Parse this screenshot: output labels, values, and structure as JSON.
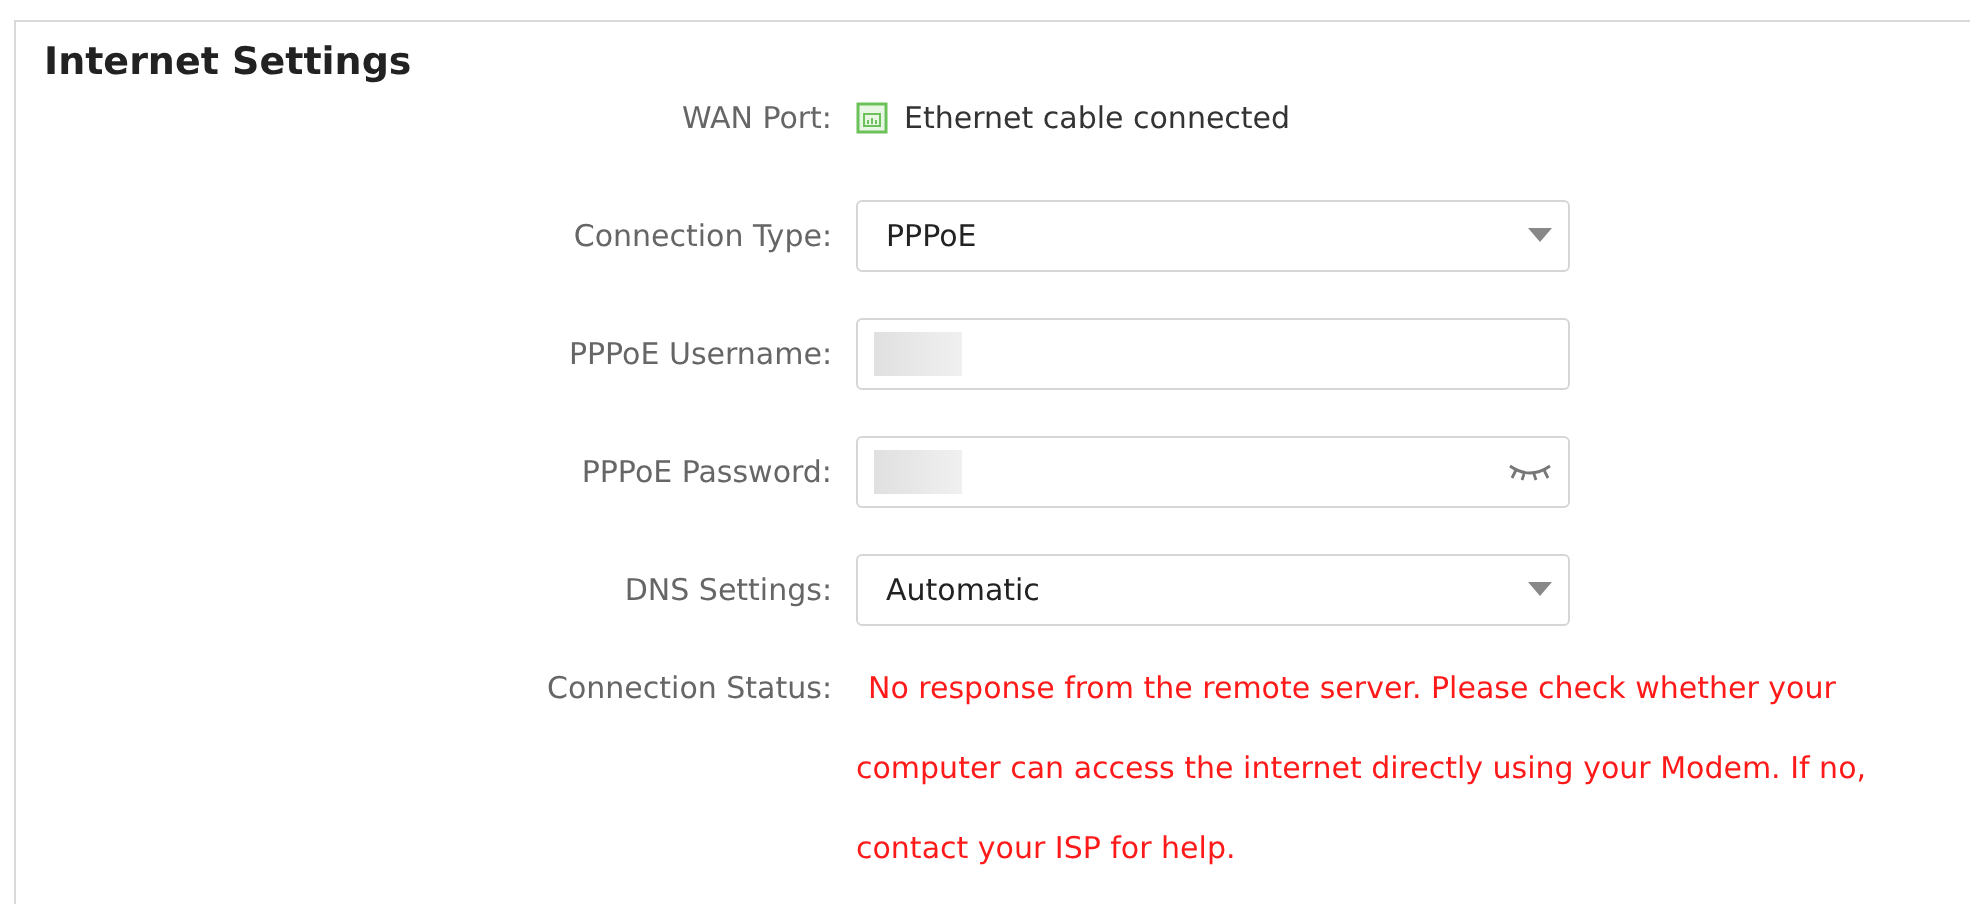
{
  "title": "Internet Settings",
  "rows": [
    {
      "kind": "status",
      "label": "WAN Port:",
      "value": "Ethernet cable connected"
    },
    {
      "kind": "select",
      "label": "Connection Type:",
      "value": "PPPoE"
    },
    {
      "kind": "text",
      "label": "PPPoE Username:",
      "redacted": true
    },
    {
      "kind": "password",
      "label": "PPPoE Password:",
      "redacted": true
    },
    {
      "kind": "select",
      "label": "DNS Settings:",
      "value": "Automatic"
    },
    {
      "kind": "message",
      "label": "Connection Status:",
      "value": "No response from the remote server. Please check whether your computer can access the internet directly using your Modem. If no, contact your ISP for help."
    }
  ]
}
